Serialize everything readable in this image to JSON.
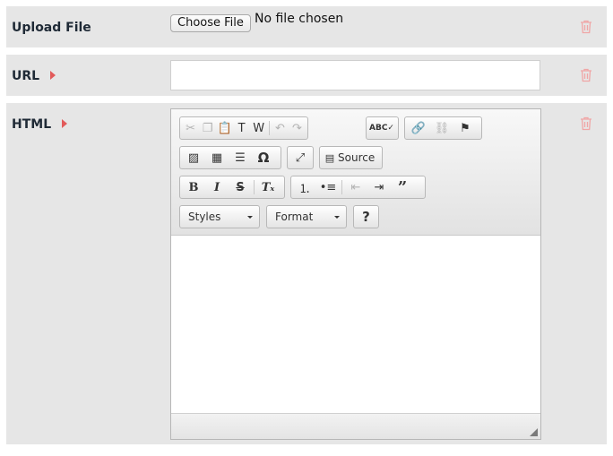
{
  "upload": {
    "label": "Upload File",
    "button_label": "Choose File",
    "status_text": "No file chosen"
  },
  "url": {
    "label": "URL",
    "value": ""
  },
  "html": {
    "label": "HTML",
    "editor": {
      "source_label": "Source",
      "styles_label": "Styles",
      "format_label": "Format",
      "help_label": "?",
      "bold_label": "B",
      "italic_label": "I",
      "strike_label": "S",
      "omega_label": "Ω",
      "quote_label": "”",
      "content": ""
    }
  },
  "colors": {
    "row_bg": "#e6e6e6",
    "accent_arrow": "#e25a5a",
    "trash_icon": "#f0a6a6",
    "label_text": "#1f2a36"
  }
}
